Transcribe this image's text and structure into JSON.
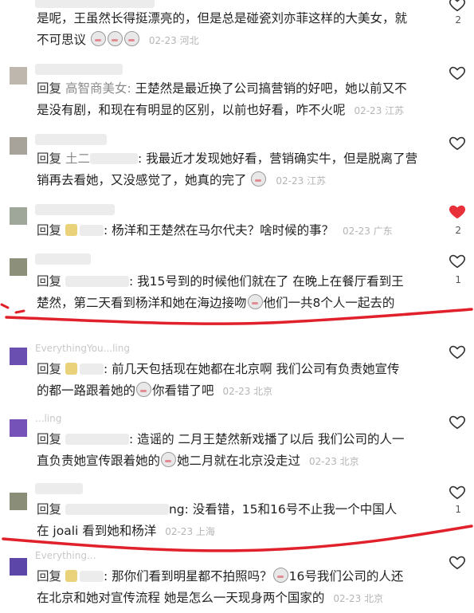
{
  "comments": [
    {
      "lines": [
        "是呢，王虽然长得挺漂亮的，但是总是碰瓷刘亦菲这样的大美女，就",
        "不可思议"
      ],
      "date": "02-23",
      "location": "河北",
      "likes": "2",
      "liked": false,
      "reply_target": ""
    },
    {
      "reply_label": "回复",
      "reply_target": "高智商美女:",
      "lines": [
        "王楚然是最近换了公司搞营销的好吧，她以前又不",
        "是没有剧，和现在有明显的区别，以前也好看，咋不火呢"
      ],
      "date": "02-23",
      "location": "江苏",
      "likes": "",
      "liked": false
    },
    {
      "reply_label": "回复",
      "reply_target": "土二",
      "lines": [
        ": 我最近才发现她好看，营销确实牛，但是脱离了营",
        "销再去看她，又没感觉了，她真的完了"
      ],
      "date": "02-23",
      "location": "江苏",
      "likes": "",
      "liked": false
    },
    {
      "reply_label": "回复",
      "reply_target": "",
      "lines": [
        ": 杨洋和王楚然在马尔代夫？啥时候的事？"
      ],
      "date": "02-23",
      "location": "广东",
      "likes": "2",
      "liked": true
    },
    {
      "reply_label": "回复",
      "reply_target": "",
      "lines": [
        ": 我15号到的时候他们就在了 在晚上在餐厅看到王",
        "楚然，第二天看到杨洋和她在海边接吻",
        "他们一共8个人一起去的"
      ],
      "date": "",
      "location": "",
      "likes": "1",
      "liked": false
    },
    {
      "username": "EverythingYou...ling",
      "reply_label": "回复",
      "reply_target": "",
      "lines": [
        ": 前几天包括现在她都在北京啊 我们公司有负责她宣传",
        "的都一路跟着她的",
        "你看错了吧"
      ],
      "date": "02-23",
      "location": "北京",
      "likes": "",
      "liked": false
    },
    {
      "username": "...ling",
      "reply_label": "回复",
      "reply_target": "",
      "lines": [
        ": 造谣的 二月王楚然新戏播了以后 我们公司的人一",
        "直负责她宣传跟着她的",
        "她二月就在北京没走过"
      ],
      "date": "02-23",
      "location": "北京",
      "likes": "",
      "liked": false
    },
    {
      "reply_label": "回复",
      "reply_target": "",
      "lines": [
        "ng: 没看错，15和16号不止我一个中国人",
        "在 joali 看到她和杨洋"
      ],
      "date": "02-23",
      "location": "上海",
      "likes": "1",
      "liked": false
    },
    {
      "username": "Everything...",
      "reply_label": "回复",
      "reply_target": "",
      "lines": [
        ": 那你们看到明星都不拍照吗？",
        "16号我们公司的人还",
        "在北京和她对宣传流程 她是怎么一天现身两个国家的"
      ],
      "date": "02-23",
      "location": "北京",
      "likes": "",
      "liked": false
    }
  ],
  "colors": {
    "accent_red": "#e0202a",
    "like_red": "#e8313b",
    "meta_gray": "#b5b5b5"
  }
}
